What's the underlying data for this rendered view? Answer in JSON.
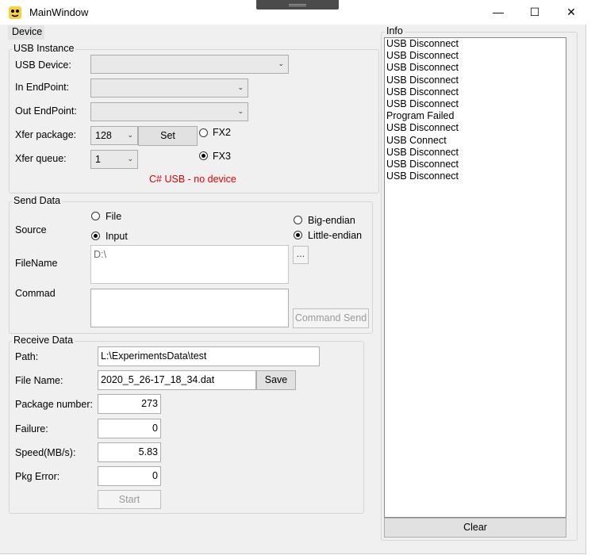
{
  "window": {
    "title": "MainWindow",
    "minimize": "—",
    "maximize": "☐",
    "close": "✕"
  },
  "menu": {
    "device": "Device"
  },
  "usb_instance": {
    "title": "USB Instance",
    "usb_device_label": "USB Device:",
    "usb_device_value": "",
    "in_endpoint_label": "In EndPoint:",
    "in_endpoint_value": "",
    "out_endpoint_label": "Out EndPoint:",
    "out_endpoint_value": "",
    "xfer_package_label": "Xfer package:",
    "xfer_package_value": "128",
    "set_button": "Set",
    "xfer_queue_label": "Xfer queue:",
    "xfer_queue_value": "1",
    "fx2_label": "FX2",
    "fx3_label": "FX3",
    "selected_fx": "FX3",
    "status_text": "C# USB - no device",
    "status_color": "#e00000"
  },
  "send_data": {
    "title": "Send Data",
    "source_label": "Source",
    "file_label": "File",
    "input_label": "Input",
    "selected_source": "Input",
    "big_endian_label": "Big-endian",
    "little_endian_label": "Little-endian",
    "selected_endian": "Little-endian",
    "filename_label": "FileName",
    "filename_value": "D:\\",
    "browse_button": "...",
    "command_label": "Commad",
    "command_value": "",
    "command_send_button": "Command Send"
  },
  "receive_data": {
    "title": "Receive Data",
    "path_label": "Path:",
    "path_value": "L:\\ExperimentsData\\test",
    "file_name_label": "File Name:",
    "file_name_value": "2020_5_26-17_18_34.dat",
    "save_button": "Save",
    "package_number_label": "Package number:",
    "package_number_value": "273",
    "failure_label": "Failure:",
    "failure_value": "0",
    "speed_label": "Speed(MB/s):",
    "speed_value": "5.83",
    "pkg_error_label": "Pkg Error:",
    "pkg_error_value": "0",
    "start_button": "Start"
  },
  "info": {
    "title": "Info",
    "items": [
      "USB Disconnect",
      "USB Disconnect",
      "USB Disconnect",
      "USB Disconnect",
      "USB Disconnect",
      "USB Disconnect",
      "Program Failed",
      "USB Disconnect",
      "USB Connect",
      "USB Disconnect",
      "USB Disconnect",
      "USB Disconnect"
    ],
    "clear_button": "Clear"
  }
}
